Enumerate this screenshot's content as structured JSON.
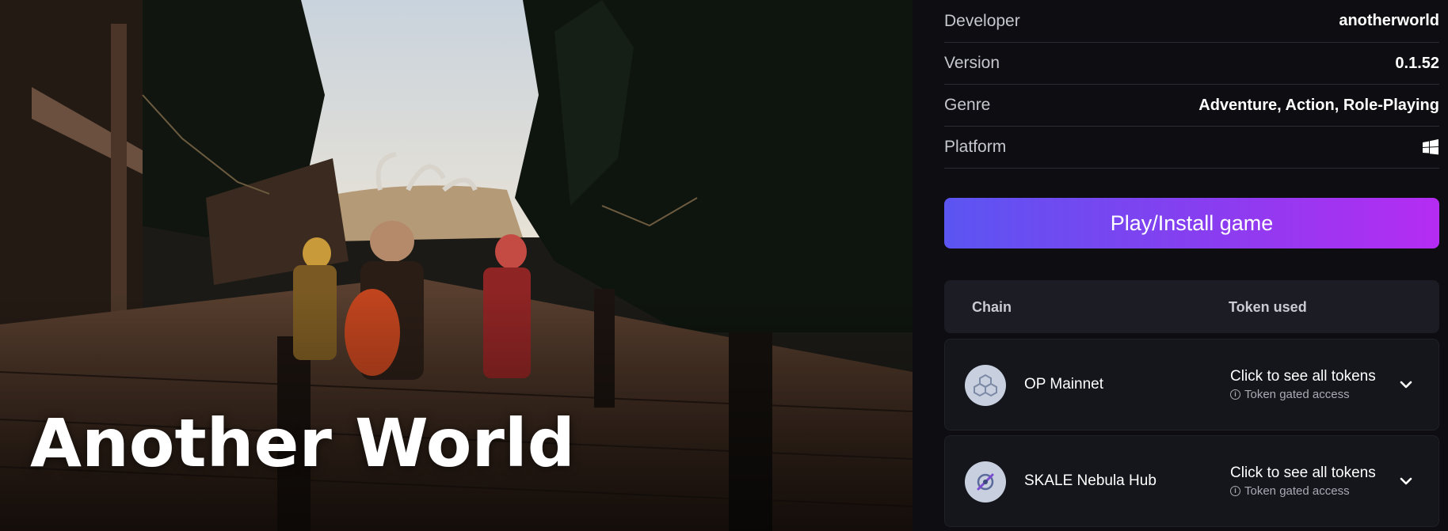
{
  "game": {
    "title": "Another World"
  },
  "details": [
    {
      "label": "Developer",
      "value": "anotherworld"
    },
    {
      "label": "Version",
      "value": "0.1.52"
    },
    {
      "label": "Genre",
      "value": "Adventure, Action, Role-Playing"
    },
    {
      "label": "Platform",
      "value": "",
      "icon": "windows-icon"
    }
  ],
  "play_button": {
    "label": "Play/Install game"
  },
  "chains_table": {
    "header": {
      "chain": "Chain",
      "token": "Token used"
    },
    "rows": [
      {
        "name": "OP Mainnet",
        "token_link": "Click to see all tokens",
        "token_note": "Token gated access",
        "icon": "op-mainnet-logo"
      },
      {
        "name": "SKALE Nebula Hub",
        "token_link": "Click to see all tokens",
        "token_note": "Token gated access",
        "icon": "skale-nebula-logo"
      }
    ]
  },
  "colors": {
    "background": "#0d0d12",
    "accent_start": "#5b55f2",
    "accent_end": "#b52cf2",
    "card": "#15161c"
  }
}
